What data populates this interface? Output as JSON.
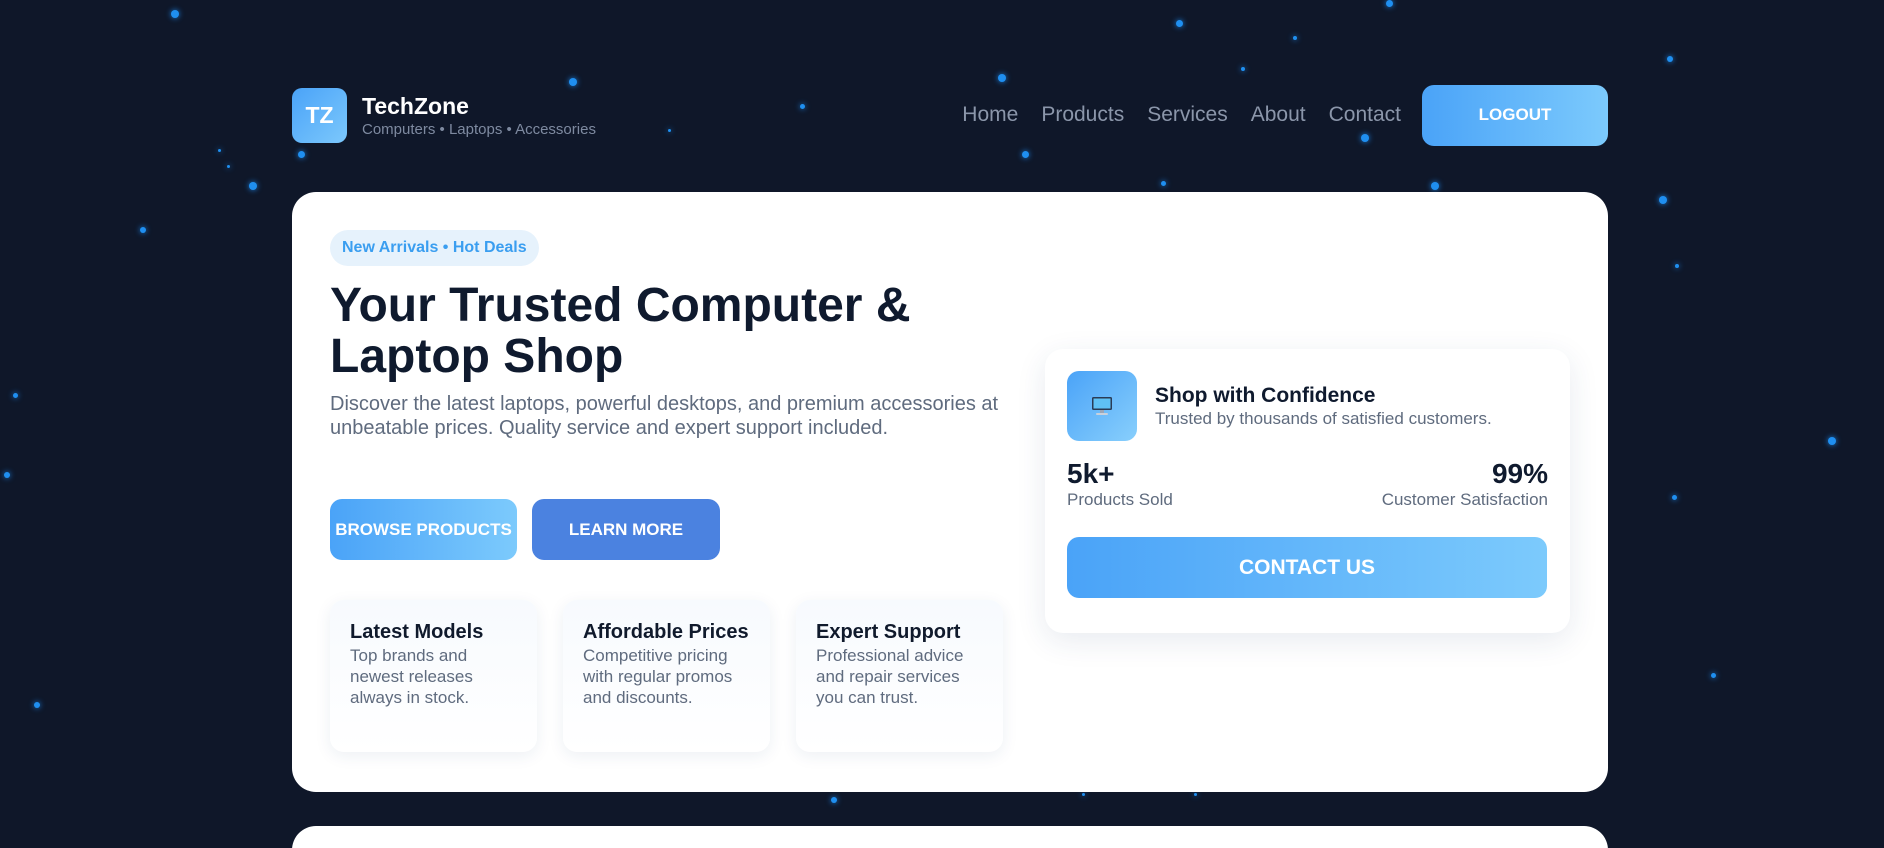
{
  "brand": {
    "logo_text": "TZ",
    "name": "TechZone",
    "tagline": "Computers • Laptops • Accessories"
  },
  "nav": {
    "items": [
      "Home",
      "Products",
      "Services",
      "About",
      "Contact"
    ],
    "logout_label": "LOGOUT"
  },
  "hero": {
    "pill": "New Arrivals • Hot Deals",
    "headline": "Your Trusted Computer & Laptop Shop",
    "lead": "Discover the latest laptops, powerful desktops, and premium accessories at unbeatable prices. Quality service and expert support included.",
    "browse_label": "BROWSE PRODUCTS",
    "learn_label": "LEARN MORE"
  },
  "features": [
    {
      "title": "Latest Models",
      "desc": "Top brands and newest releases always in stock."
    },
    {
      "title": "Affordable Prices",
      "desc": "Competitive pricing with regular promos and discounts."
    },
    {
      "title": "Expert Support",
      "desc": "Professional advice and repair services you can trust."
    }
  ],
  "confidence": {
    "icon": "computer-icon",
    "title": "Shop with Confidence",
    "subtitle": "Trusted by thousands of satisfied customers.",
    "stats": [
      {
        "value": "5k+",
        "label": "Products Sold"
      },
      {
        "value": "99%",
        "label": "Customer Satisfaction"
      }
    ],
    "contact_label": "CONTACT US"
  },
  "colors": {
    "background": "#0f1729",
    "accent_start": "#4aa3f8",
    "accent_end": "#7ccafc",
    "secondary_button": "#4b82e0",
    "star": "#1f8ff0"
  }
}
